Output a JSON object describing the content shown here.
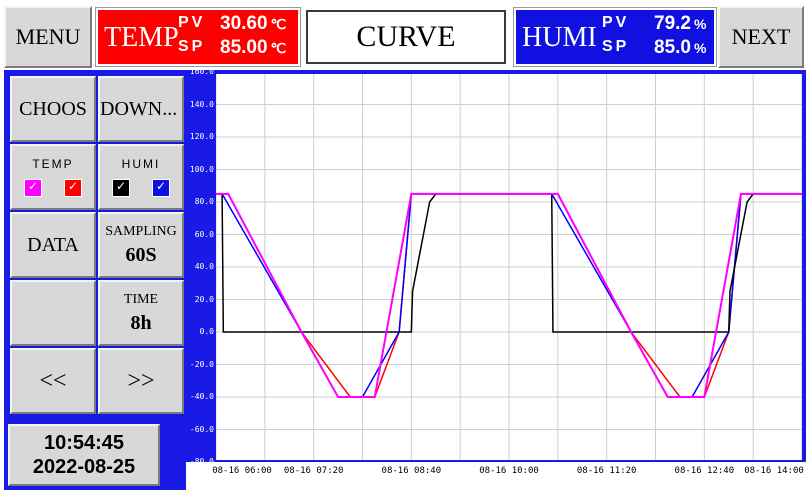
{
  "header": {
    "menu_label": "MENU",
    "next_label": "NEXT",
    "title": "CURVE",
    "temp": {
      "label": "TEMP",
      "pv_label": "PV",
      "sp_label": "SP",
      "pv": "30.60",
      "sp": "85.00",
      "unit": "℃",
      "color": "#ff0000"
    },
    "humi": {
      "label": "HUMI",
      "pv_label": "PV",
      "sp_label": "SP",
      "pv": "79.2",
      "sp": "85.0",
      "unit": "%",
      "color": "#1010e0"
    }
  },
  "sidebar": {
    "choose_label": "CHOOS",
    "down_label": "DOWN...",
    "temp_label": "TEMP",
    "humi_label": "HUMI",
    "checkboxes": [
      {
        "name": "temp-pv",
        "checked": true,
        "color": "#ff00ff"
      },
      {
        "name": "temp-sp",
        "checked": true,
        "color": "#ff0000"
      },
      {
        "name": "humi-pv",
        "checked": true,
        "color": "#000000"
      },
      {
        "name": "humi-sp",
        "checked": true,
        "color": "#0000ff"
      }
    ],
    "data_label": "DATA",
    "sampling_label": "SAMPLING",
    "sampling_value": "60S",
    "time_label": "TIME",
    "time_value": "8h",
    "prev_label": "<<",
    "next_label": ">>",
    "clock_time": "10:54:45",
    "clock_date": "2022-08-25"
  },
  "chart_data": {
    "type": "line",
    "ylim": [
      -80,
      160
    ],
    "yticks": [
      "160.0",
      "140.0",
      "120.0",
      "100.0",
      "80.0",
      "60.0",
      "40.0",
      "20.0",
      "0.0",
      "-20.0",
      "-40.0",
      "-60.0",
      "-80.0"
    ],
    "xlim": [
      "08-16 06:00",
      "08-16 14:00"
    ],
    "xticks": [
      "08-16 06:00",
      "08-16 07:20",
      "08-16 08:40",
      "08-16 10:00",
      "08-16 11:20",
      "08-16 12:40",
      "08-16 14:00"
    ],
    "grid": true,
    "series": [
      {
        "color": "#ff0000",
        "x": [
          "08-16 06:00",
          "08-16 06:10",
          "08-16 07:10",
          "08-16 07:50",
          "08-16 08:10",
          "08-16 08:30",
          "08-16 08:40",
          "08-16 10:30",
          "08-16 10:40",
          "08-16 11:40",
          "08-16 12:20",
          "08-16 12:40",
          "08-16 13:00",
          "08-16 13:10",
          "08-16 14:00"
        ],
        "values": [
          85,
          85,
          0,
          -40,
          -40,
          0,
          85,
          85,
          85,
          0,
          -40,
          -40,
          0,
          85,
          85
        ]
      },
      {
        "color": "#0000ff",
        "x": [
          "08-16 06:00",
          "08-16 06:05",
          "08-16 07:10",
          "08-16 07:40",
          "08-16 08:00",
          "08-16 08:30",
          "08-16 08:40",
          "08-16 10:30",
          "08-16 10:35",
          "08-16 11:40",
          "08-16 12:10",
          "08-16 12:30",
          "08-16 13:00",
          "08-16 13:10",
          "08-16 14:00"
        ],
        "values": [
          85,
          85,
          0,
          -40,
          -40,
          0,
          85,
          85,
          85,
          0,
          -40,
          -40,
          0,
          85,
          85
        ]
      },
      {
        "color": "#000000",
        "x": [
          "08-16 06:00",
          "08-16 06:05",
          "08-16 06:06",
          "08-16 08:40",
          "08-16 08:41",
          "08-16 08:55",
          "08-16 09:00",
          "08-16 10:35",
          "08-16 10:36",
          "08-16 13:00",
          "08-16 13:01",
          "08-16 13:15",
          "08-16 13:20",
          "08-16 14:00"
        ],
        "values": [
          85,
          85,
          0,
          0,
          25,
          80,
          85,
          85,
          0,
          0,
          25,
          80,
          85,
          85
        ]
      },
      {
        "color": "#ff00ff",
        "x": [
          "08-16 06:00",
          "08-16 06:10",
          "08-16 07:10",
          "08-16 07:40",
          "08-16 08:10",
          "08-16 08:40",
          "08-16 10:30",
          "08-16 10:40",
          "08-16 11:40",
          "08-16 12:10",
          "08-16 12:40",
          "08-16 13:10",
          "08-16 14:00"
        ],
        "values": [
          85,
          85,
          0,
          -40,
          -40,
          85,
          85,
          85,
          0,
          -40,
          -40,
          85,
          85
        ]
      }
    ]
  }
}
